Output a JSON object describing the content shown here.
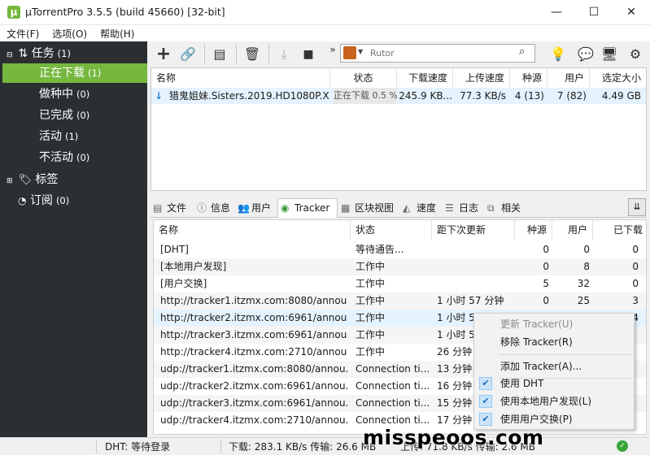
{
  "window": {
    "title": "µTorrentPro 3.5.5  (build 45660) [32-bit]",
    "minimize": "—",
    "maximize": "☐",
    "close": "✕"
  },
  "menubar": [
    "文件(F)",
    "选项(O)",
    "帮助(H)"
  ],
  "sidebar": {
    "tasks": {
      "label": "任务",
      "count": "(1)"
    },
    "items": [
      {
        "label": "正在下载",
        "count": "(1)"
      },
      {
        "label": "做种中",
        "count": "(0)"
      },
      {
        "label": "已完成",
        "count": "(0)"
      },
      {
        "label": "活动",
        "count": "(1)"
      },
      {
        "label": "不活动",
        "count": "(0)"
      }
    ],
    "labels": {
      "label": "标签"
    },
    "feeds": {
      "label": "订阅",
      "count": "(0)"
    }
  },
  "toolbar": {
    "search_placeholder": "Rutor",
    "more": "»"
  },
  "torrent_list": {
    "columns": [
      "名称",
      "状态",
      "下载速度",
      "上传速度",
      "种源",
      "用户",
      "选定大小"
    ],
    "rows": [
      {
        "name": "猎鬼姐妹.Sisters.2019.HD1080P.X...",
        "status": "正在下载 0.5 %",
        "down": "245.9 KB...",
        "up": "77.3 KB/s",
        "seeds": "4 (13)",
        "peers": "7 (82)",
        "size": "4.49 GB"
      }
    ]
  },
  "tabs": [
    "文件",
    "信息",
    "用户",
    "Tracker",
    "区块视图",
    "速度",
    "日志",
    "相关"
  ],
  "tracker_list": {
    "columns": [
      "名称",
      "状态",
      "距下次更新",
      "种源",
      "用户",
      "已下载"
    ],
    "rows": [
      {
        "name": "[DHT]",
        "status": "等待通告...",
        "next": "",
        "seeds": "0",
        "peers": "0",
        "downloaded": "0"
      },
      {
        "name": "[本地用户发现]",
        "status": "工作中",
        "next": "",
        "seeds": "0",
        "peers": "8",
        "downloaded": "0"
      },
      {
        "name": "[用户交换]",
        "status": "工作中",
        "next": "",
        "seeds": "5",
        "peers": "32",
        "downloaded": "0"
      },
      {
        "name": "http://tracker1.itzmx.com:8080/annou...",
        "status": "工作中",
        "next": "1 小时 57 分钟",
        "seeds": "0",
        "peers": "25",
        "downloaded": "3"
      },
      {
        "name": "http://tracker2.itzmx.com:6961/annou...",
        "status": "工作中",
        "next": "1 小时 5",
        "seeds": "",
        "peers": "",
        "downloaded": "4"
      },
      {
        "name": "http://tracker3.itzmx.com:6961/annou...",
        "status": "工作中",
        "next": "1 小时 5",
        "seeds": "",
        "peers": "",
        "downloaded": ""
      },
      {
        "name": "http://tracker4.itzmx.com:2710/annou...",
        "status": "工作中",
        "next": "26 分钟",
        "seeds": "",
        "peers": "",
        "downloaded": ""
      },
      {
        "name": "udp://tracker1.itzmx.com:8080/annou...",
        "status": "Connection ti...",
        "next": "13 分钟",
        "seeds": "",
        "peers": "",
        "downloaded": ""
      },
      {
        "name": "udp://tracker2.itzmx.com:6961/annou...",
        "status": "Connection ti...",
        "next": "16 分钟",
        "seeds": "",
        "peers": "",
        "downloaded": ""
      },
      {
        "name": "udp://tracker3.itzmx.com:6961/annou...",
        "status": "Connection ti...",
        "next": "15 分钟",
        "seeds": "",
        "peers": "",
        "downloaded": ""
      },
      {
        "name": "udp://tracker4.itzmx.com:2710/annou...",
        "status": "Connection ti...",
        "next": "17 分钟",
        "seeds": "",
        "peers": "",
        "downloaded": ""
      }
    ]
  },
  "context_menu": {
    "update": "更新 Tracker(U)",
    "remove": "移除 Tracker(R)",
    "add": "添加 Tracker(A)...",
    "dht": "使用 DHT",
    "lpd": "使用本地用户发现(L)",
    "pex": "使用用户交换(P)"
  },
  "statusbar": {
    "dht": "DHT: 等待登录",
    "download": "下载: 283.1 KB/s 传输: 26.6 MB",
    "upload": "上传: 71.8 KB/s 传输: 2.6 MB"
  },
  "watermark": "misspeoos.com",
  "colors": {
    "accent": "#76b83f",
    "sidebar": "#2b2f32",
    "selection": "#e5f3ff",
    "download_arrow": "#2a7fd4"
  }
}
